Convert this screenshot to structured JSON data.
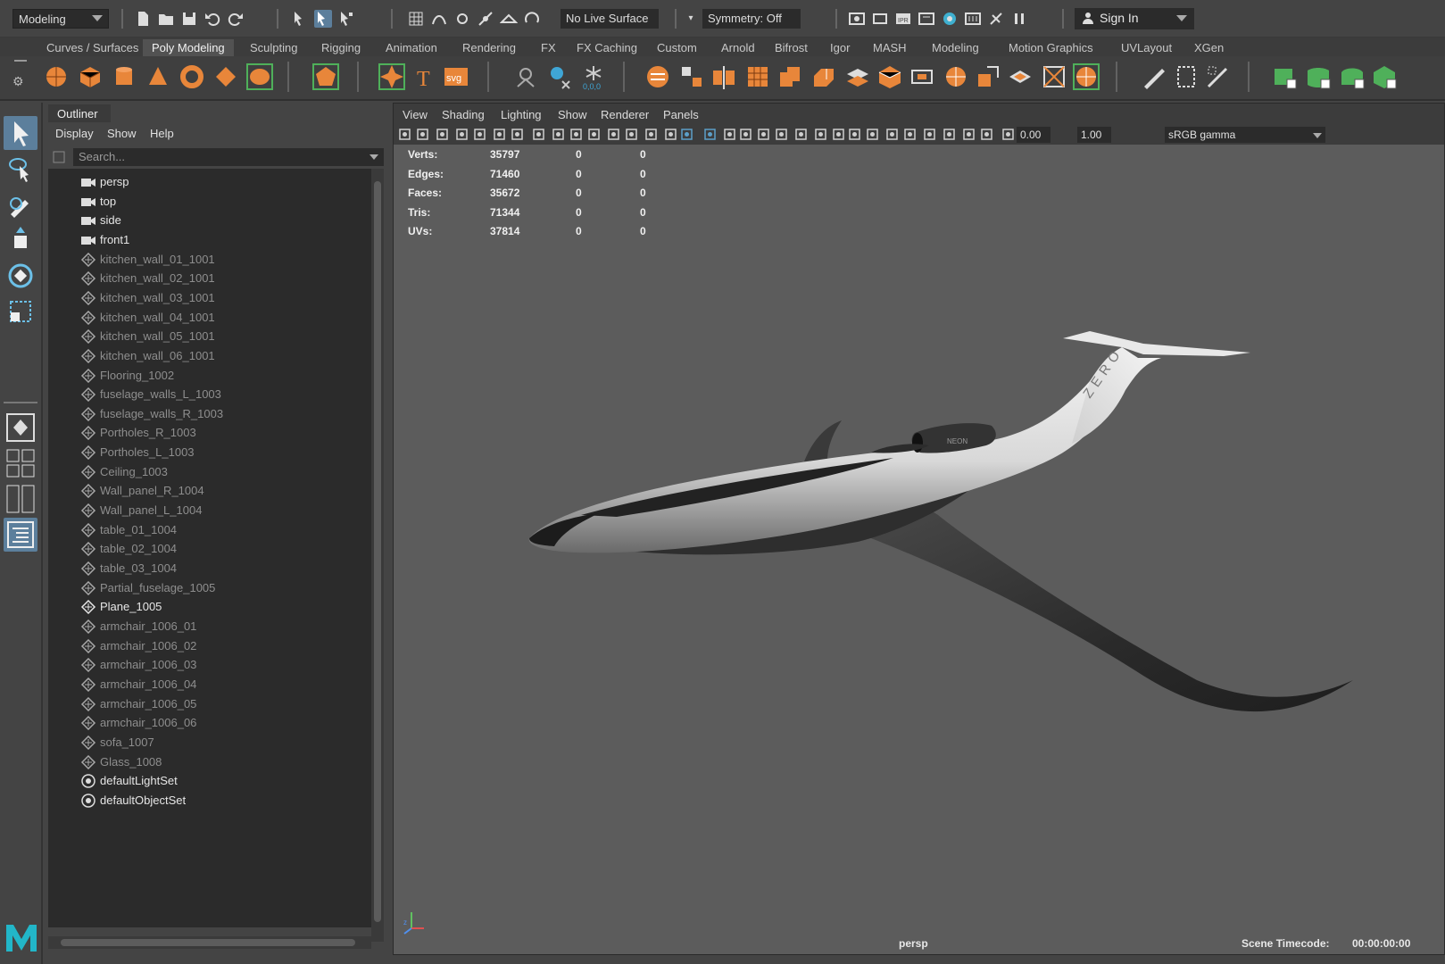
{
  "statusline": {
    "mode": "Modeling",
    "live_surface": "No Live Surface",
    "symmetry": "Symmetry: Off",
    "sign_in": "Sign In"
  },
  "shelf_tabs": [
    "Curves / Surfaces",
    "Poly Modeling",
    "Sculpting",
    "Rigging",
    "Animation",
    "Rendering",
    "FX",
    "FX Caching",
    "Custom",
    "Arnold",
    "Bifrost",
    "Igor",
    "MASH",
    "Modeling",
    "Motion Graphics",
    "UVLayout",
    "XGen"
  ],
  "active_shelf_tab": "Poly Modeling",
  "shelf_text_icons": {
    "text_tool": "T",
    "svg_tool": "svg",
    "origin_readout": "0,0,0"
  },
  "outliner": {
    "title": "Outliner",
    "menu": [
      "Display",
      "Show",
      "Help"
    ],
    "search_placeholder": "Search...",
    "items": [
      {
        "label": "persp",
        "type": "camera"
      },
      {
        "label": "top",
        "type": "camera"
      },
      {
        "label": "side",
        "type": "camera"
      },
      {
        "label": "front1",
        "type": "camera"
      },
      {
        "label": "kitchen_wall_01_1001",
        "type": "mesh-hidden"
      },
      {
        "label": "kitchen_wall_02_1001",
        "type": "mesh-hidden"
      },
      {
        "label": "kitchen_wall_03_1001",
        "type": "mesh-hidden"
      },
      {
        "label": "kitchen_wall_04_1001",
        "type": "mesh-hidden"
      },
      {
        "label": "kitchen_wall_05_1001",
        "type": "mesh-hidden"
      },
      {
        "label": "kitchen_wall_06_1001",
        "type": "mesh-hidden"
      },
      {
        "label": "Flooring_1002",
        "type": "mesh-hidden"
      },
      {
        "label": "fuselage_walls_L_1003",
        "type": "mesh-hidden"
      },
      {
        "label": "fuselage_walls_R_1003",
        "type": "mesh-hidden"
      },
      {
        "label": "Portholes_R_1003",
        "type": "mesh-hidden"
      },
      {
        "label": "Portholes_L_1003",
        "type": "mesh-hidden"
      },
      {
        "label": "Ceiling_1003",
        "type": "mesh-hidden"
      },
      {
        "label": "Wall_panel_R_1004",
        "type": "mesh-hidden"
      },
      {
        "label": "Wall_panel_L_1004",
        "type": "mesh-hidden"
      },
      {
        "label": "table_01_1004",
        "type": "mesh-hidden"
      },
      {
        "label": "table_02_1004",
        "type": "mesh-hidden"
      },
      {
        "label": "table_03_1004",
        "type": "mesh-hidden"
      },
      {
        "label": "Partial_fuselage_1005",
        "type": "mesh-hidden"
      },
      {
        "label": "Plane_1005",
        "type": "mesh"
      },
      {
        "label": "armchair_1006_01",
        "type": "mesh-hidden"
      },
      {
        "label": "armchair_1006_02",
        "type": "mesh-hidden"
      },
      {
        "label": "armchair_1006_03",
        "type": "mesh-hidden"
      },
      {
        "label": "armchair_1006_04",
        "type": "mesh-hidden"
      },
      {
        "label": "armchair_1006_05",
        "type": "mesh-hidden"
      },
      {
        "label": "armchair_1006_06",
        "type": "mesh-hidden"
      },
      {
        "label": "sofa_1007",
        "type": "mesh-hidden"
      },
      {
        "label": "Glass_1008",
        "type": "mesh-hidden"
      },
      {
        "label": "defaultLightSet",
        "type": "set"
      },
      {
        "label": "defaultObjectSet",
        "type": "set"
      }
    ]
  },
  "viewport": {
    "menu": [
      "View",
      "Shading",
      "Lighting",
      "Show",
      "Renderer",
      "Panels"
    ],
    "exposure": "0.00",
    "gamma": "1.00",
    "color_space": "sRGB gamma",
    "hud": [
      {
        "label": "Verts:",
        "v1": "35797",
        "v2": "0",
        "v3": "0"
      },
      {
        "label": "Edges:",
        "v1": "71460",
        "v2": "0",
        "v3": "0"
      },
      {
        "label": "Faces:",
        "v1": "35672",
        "v2": "0",
        "v3": "0"
      },
      {
        "label": "Tris:",
        "v1": "71344",
        "v2": "0",
        "v3": "0"
      },
      {
        "label": "UVs:",
        "v1": "37814",
        "v2": "0",
        "v3": "0"
      }
    ],
    "camera": "persp",
    "timecode_label": "Scene Timecode:",
    "timecode": "00:00:00:00",
    "tail_text": "ZERO",
    "engine_text": "NEON"
  },
  "colors": {
    "selection": "#5c7f9c",
    "shelf_orange": "#e8863a",
    "shelf_green": "#4fb05a",
    "viewport_bg": "#5c5c5c"
  }
}
